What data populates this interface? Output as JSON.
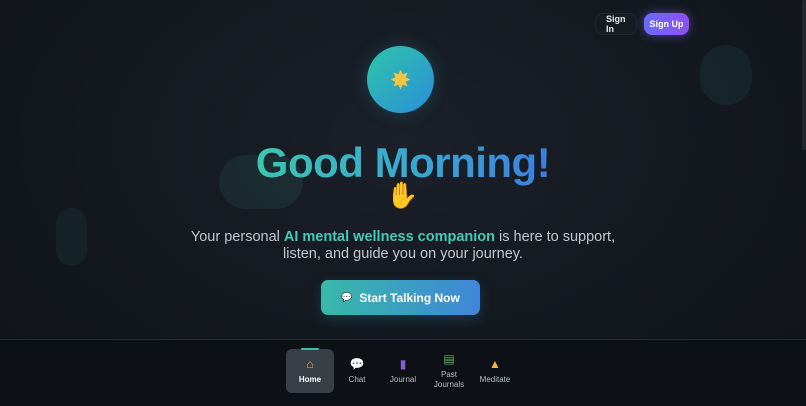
{
  "header": {
    "sign_in_label": "Sign In",
    "sign_up_label": "Sign Up"
  },
  "hero": {
    "icon": "sun-icon",
    "greeting": "Good Morning!",
    "wave_icon": "waving-hand-icon",
    "subtitle_before": "Your personal ",
    "subtitle_highlight": "AI mental wellness companion",
    "subtitle_after": " is here to support, listen, and guide you on your journey.",
    "cta_icon": "speech-bubble-icon",
    "cta_label": "Start Talking Now"
  },
  "nav": {
    "items": [
      {
        "label": "Home",
        "icon": "house-icon",
        "active": true
      },
      {
        "label": "Chat",
        "icon": "speech-bubble-icon",
        "active": false
      },
      {
        "label": "Journal",
        "icon": "notebook-icon",
        "active": false
      },
      {
        "label": "Past Journals",
        "icon": "books-icon",
        "active": false
      },
      {
        "label": "Meditate",
        "icon": "meditation-icon",
        "active": false
      }
    ]
  },
  "colors": {
    "background": "#14181f",
    "accent_teal": "#3bc7b0",
    "accent_blue": "#3b7fe0",
    "signup_purple": "#8c4ff0"
  }
}
